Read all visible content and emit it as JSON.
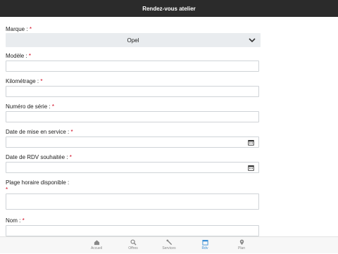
{
  "header": {
    "title": "Rendez-vous atelier"
  },
  "form": {
    "marque": {
      "label": "Marque :",
      "req": "*",
      "value": "Opel"
    },
    "modele": {
      "label": "Modèle :",
      "req": "*"
    },
    "kilometrage": {
      "label": "Kilométrage :",
      "req": "*"
    },
    "numero_serie": {
      "label": "Numéro de série :",
      "req": "*"
    },
    "date_mise_service": {
      "label": "Date de mise en service :",
      "req": "*"
    },
    "date_rdv": {
      "label": "Date de RDV souhaitée :",
      "req": "*"
    },
    "plage_horaire": {
      "label": "Plage horaire disponible :",
      "req": "*"
    },
    "nom": {
      "label": "Nom :",
      "req": "*"
    }
  },
  "tabs": [
    {
      "label": "Accueil",
      "icon": "home-icon"
    },
    {
      "label": "Offres",
      "icon": "search-icon"
    },
    {
      "label": "Services",
      "icon": "wrench-icon"
    },
    {
      "label": "Rdv",
      "icon": "calendar-icon"
    },
    {
      "label": "Plan",
      "icon": "map-pin-icon"
    }
  ],
  "colors": {
    "active_tab": "#3a8fd6",
    "header_bg": "#2b2b2b",
    "required": "#d0021b"
  }
}
